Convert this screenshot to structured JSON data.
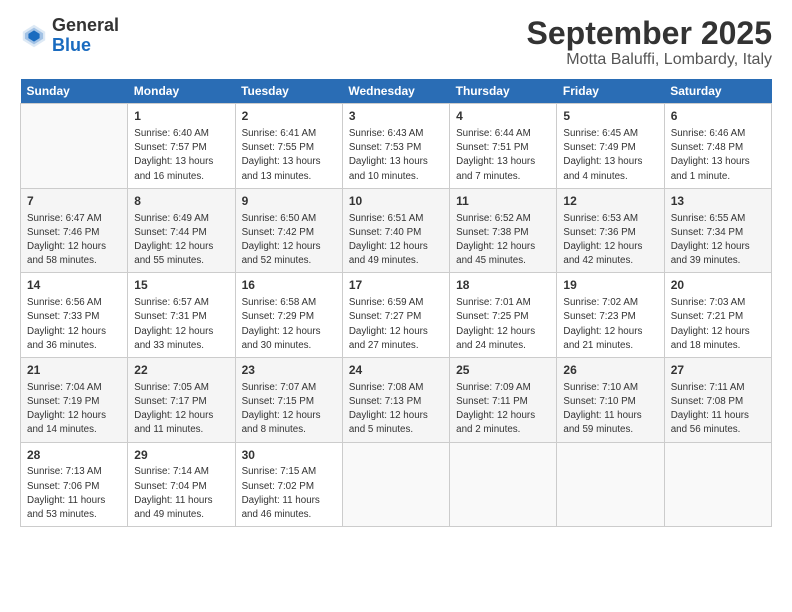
{
  "logo": {
    "general": "General",
    "blue": "Blue"
  },
  "title": "September 2025",
  "location": "Motta Baluffi, Lombardy, Italy",
  "days_header": [
    "Sunday",
    "Monday",
    "Tuesday",
    "Wednesday",
    "Thursday",
    "Friday",
    "Saturday"
  ],
  "weeks": [
    [
      {
        "day": "",
        "info": ""
      },
      {
        "day": "1",
        "info": "Sunrise: 6:40 AM\nSunset: 7:57 PM\nDaylight: 13 hours\nand 16 minutes."
      },
      {
        "day": "2",
        "info": "Sunrise: 6:41 AM\nSunset: 7:55 PM\nDaylight: 13 hours\nand 13 minutes."
      },
      {
        "day": "3",
        "info": "Sunrise: 6:43 AM\nSunset: 7:53 PM\nDaylight: 13 hours\nand 10 minutes."
      },
      {
        "day": "4",
        "info": "Sunrise: 6:44 AM\nSunset: 7:51 PM\nDaylight: 13 hours\nand 7 minutes."
      },
      {
        "day": "5",
        "info": "Sunrise: 6:45 AM\nSunset: 7:49 PM\nDaylight: 13 hours\nand 4 minutes."
      },
      {
        "day": "6",
        "info": "Sunrise: 6:46 AM\nSunset: 7:48 PM\nDaylight: 13 hours\nand 1 minute."
      }
    ],
    [
      {
        "day": "7",
        "info": "Sunrise: 6:47 AM\nSunset: 7:46 PM\nDaylight: 12 hours\nand 58 minutes."
      },
      {
        "day": "8",
        "info": "Sunrise: 6:49 AM\nSunset: 7:44 PM\nDaylight: 12 hours\nand 55 minutes."
      },
      {
        "day": "9",
        "info": "Sunrise: 6:50 AM\nSunset: 7:42 PM\nDaylight: 12 hours\nand 52 minutes."
      },
      {
        "day": "10",
        "info": "Sunrise: 6:51 AM\nSunset: 7:40 PM\nDaylight: 12 hours\nand 49 minutes."
      },
      {
        "day": "11",
        "info": "Sunrise: 6:52 AM\nSunset: 7:38 PM\nDaylight: 12 hours\nand 45 minutes."
      },
      {
        "day": "12",
        "info": "Sunrise: 6:53 AM\nSunset: 7:36 PM\nDaylight: 12 hours\nand 42 minutes."
      },
      {
        "day": "13",
        "info": "Sunrise: 6:55 AM\nSunset: 7:34 PM\nDaylight: 12 hours\nand 39 minutes."
      }
    ],
    [
      {
        "day": "14",
        "info": "Sunrise: 6:56 AM\nSunset: 7:33 PM\nDaylight: 12 hours\nand 36 minutes."
      },
      {
        "day": "15",
        "info": "Sunrise: 6:57 AM\nSunset: 7:31 PM\nDaylight: 12 hours\nand 33 minutes."
      },
      {
        "day": "16",
        "info": "Sunrise: 6:58 AM\nSunset: 7:29 PM\nDaylight: 12 hours\nand 30 minutes."
      },
      {
        "day": "17",
        "info": "Sunrise: 6:59 AM\nSunset: 7:27 PM\nDaylight: 12 hours\nand 27 minutes."
      },
      {
        "day": "18",
        "info": "Sunrise: 7:01 AM\nSunset: 7:25 PM\nDaylight: 12 hours\nand 24 minutes."
      },
      {
        "day": "19",
        "info": "Sunrise: 7:02 AM\nSunset: 7:23 PM\nDaylight: 12 hours\nand 21 minutes."
      },
      {
        "day": "20",
        "info": "Sunrise: 7:03 AM\nSunset: 7:21 PM\nDaylight: 12 hours\nand 18 minutes."
      }
    ],
    [
      {
        "day": "21",
        "info": "Sunrise: 7:04 AM\nSunset: 7:19 PM\nDaylight: 12 hours\nand 14 minutes."
      },
      {
        "day": "22",
        "info": "Sunrise: 7:05 AM\nSunset: 7:17 PM\nDaylight: 12 hours\nand 11 minutes."
      },
      {
        "day": "23",
        "info": "Sunrise: 7:07 AM\nSunset: 7:15 PM\nDaylight: 12 hours\nand 8 minutes."
      },
      {
        "day": "24",
        "info": "Sunrise: 7:08 AM\nSunset: 7:13 PM\nDaylight: 12 hours\nand 5 minutes."
      },
      {
        "day": "25",
        "info": "Sunrise: 7:09 AM\nSunset: 7:11 PM\nDaylight: 12 hours\nand 2 minutes."
      },
      {
        "day": "26",
        "info": "Sunrise: 7:10 AM\nSunset: 7:10 PM\nDaylight: 11 hours\nand 59 minutes."
      },
      {
        "day": "27",
        "info": "Sunrise: 7:11 AM\nSunset: 7:08 PM\nDaylight: 11 hours\nand 56 minutes."
      }
    ],
    [
      {
        "day": "28",
        "info": "Sunrise: 7:13 AM\nSunset: 7:06 PM\nDaylight: 11 hours\nand 53 minutes."
      },
      {
        "day": "29",
        "info": "Sunrise: 7:14 AM\nSunset: 7:04 PM\nDaylight: 11 hours\nand 49 minutes."
      },
      {
        "day": "30",
        "info": "Sunrise: 7:15 AM\nSunset: 7:02 PM\nDaylight: 11 hours\nand 46 minutes."
      },
      {
        "day": "",
        "info": ""
      },
      {
        "day": "",
        "info": ""
      },
      {
        "day": "",
        "info": ""
      },
      {
        "day": "",
        "info": ""
      }
    ]
  ]
}
